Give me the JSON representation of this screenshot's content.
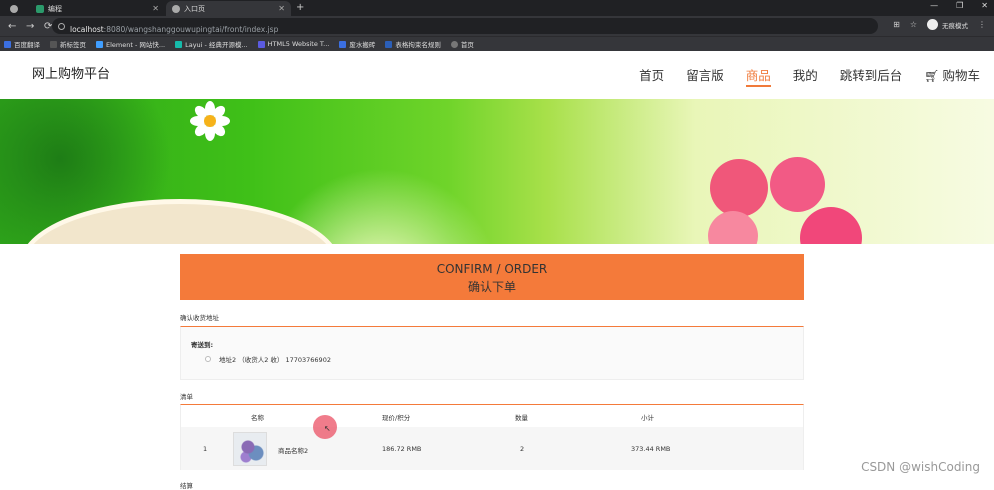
{
  "browser": {
    "tabs": [
      {
        "label": "",
        "active": false
      },
      {
        "label": "编程",
        "active": false
      },
      {
        "label": "入口页",
        "active": true
      }
    ],
    "new_tab": "+",
    "window_controls": [
      "—",
      "❐",
      "✕"
    ],
    "url_host": "localhost",
    "url_path": ":8080/wangshanggouwupingtai/front/index.jsp",
    "incognito_label": "无痕模式",
    "bookmarks": [
      {
        "label": "百度翻译",
        "color": "#3b6fe0"
      },
      {
        "label": "新标签页",
        "color": "#444"
      },
      {
        "label": "Element - 网站快...",
        "color": "#409eff"
      },
      {
        "label": "Layui - 经典开源模...",
        "color": "#16baaa"
      },
      {
        "label": "HTML5 Website T...",
        "color": "#5b5be0"
      },
      {
        "label": "废水搬砖",
        "color": "#3b6fe0"
      },
      {
        "label": "表格拘束名规则",
        "color": "#2b5fb8"
      },
      {
        "label": "首页",
        "color": "#666"
      }
    ]
  },
  "site": {
    "brand": "网上购物平台",
    "nav": [
      {
        "label": "首页",
        "active": false
      },
      {
        "label": "留言版",
        "active": false
      },
      {
        "label": "商品",
        "active": true
      },
      {
        "label": "我的",
        "active": false
      },
      {
        "label": "跳转到后台",
        "active": false
      },
      {
        "label": "购物车",
        "active": false
      }
    ],
    "accent": "#f47a3a"
  },
  "order": {
    "title_en": "CONFIRM / ORDER",
    "title_cn": "确认下单",
    "address_section": "确认收货地址",
    "send_to": "寄送到:",
    "address_option": "地址2 （收货人2 收） 17703766902",
    "list_section": "清单",
    "table_headers": [
      "名称",
      "现价/积分",
      "数量",
      "小计"
    ],
    "items": [
      {
        "index": "1",
        "name": "商品名称2",
        "price": "186.72 RMB",
        "qty": "2",
        "subtotal": "373.44 RMB"
      }
    ],
    "next_section": "结算"
  },
  "watermark": "CSDN @wishCoding"
}
